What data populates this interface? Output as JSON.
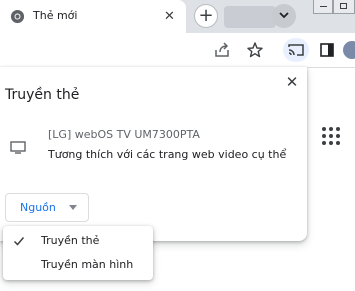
{
  "tab": {
    "title": "Thẻ mới",
    "favicon": "chrome-icon",
    "close_icon": "close-icon"
  },
  "tabstrip": {
    "new_tab_icon": "plus-icon",
    "tab_search_icon": "chevron-down-icon"
  },
  "toolbar": {
    "share_icon": "share-icon",
    "bookmark_icon": "star-icon",
    "cast_icon": "cast-icon",
    "side_panel_icon": "side-panel-icon",
    "cast_active_bg": "#e8f0fe"
  },
  "cast_dialog": {
    "title": "Truyền thẻ",
    "close_icon": "close-icon",
    "sink": {
      "name": "[LG] webOS TV UM7300PTA",
      "status": "Tương thích với các trang web video cụ thể",
      "icon": "tv-icon"
    },
    "source_button": {
      "label": "Nguồn",
      "accent": "#1a73e8"
    }
  },
  "source_menu": {
    "items": [
      {
        "label": "Truyền thẻ",
        "checked": true
      },
      {
        "label": "Truyền màn hình",
        "checked": false
      }
    ]
  }
}
